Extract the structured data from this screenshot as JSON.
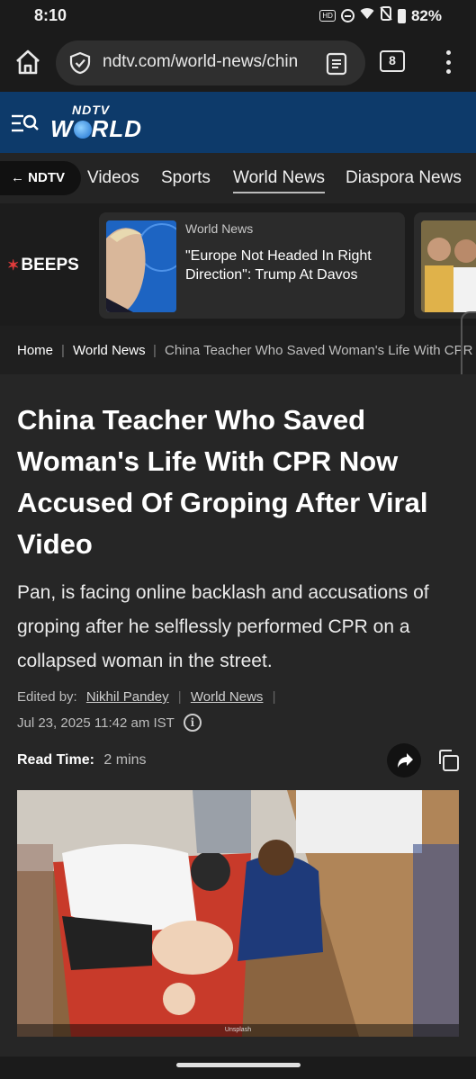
{
  "status_bar": {
    "time": "8:10",
    "battery": "82%",
    "hd_badge": "HD"
  },
  "browser": {
    "url": "ndtv.com/world-news/chin",
    "tab_count": "8"
  },
  "site": {
    "logo_top": "NDTV",
    "logo_bottom_pre": "W",
    "logo_bottom_post": "RLD"
  },
  "nav": {
    "back_label": "← NDTV",
    "items": [
      {
        "label": "Videos"
      },
      {
        "label": "Sports"
      },
      {
        "label": "World News"
      },
      {
        "label": "Diaspora News"
      }
    ]
  },
  "beeps": {
    "label": "BEEPS",
    "card": {
      "category": "World News",
      "title": "\"Europe Not Headed In Right Direction\": Trump At Davos"
    }
  },
  "breadcrumb": {
    "home": "Home",
    "section": "World News",
    "current": "China Teacher Who Saved Woman's Life With CPR"
  },
  "article": {
    "headline": "China Teacher Who Saved Woman's Life With CPR Now Accused Of Groping After Viral Video",
    "summary": "Pan, is facing online backlash and accusations of groping after he selflessly performed CPR on a collapsed woman in the street.",
    "edited_by_label": "Edited by:",
    "editor": "Nikhil Pandey",
    "section_link": "World News",
    "date": "Jul 23, 2025 11:42 am IST",
    "read_time_label": "Read Time:",
    "read_time_value": "2 mins",
    "photo_credit": "Unsplash"
  },
  "colors": {
    "header_blue": "#0d3a6a",
    "beeps_star": "#e23b3b",
    "background": "#262626"
  }
}
